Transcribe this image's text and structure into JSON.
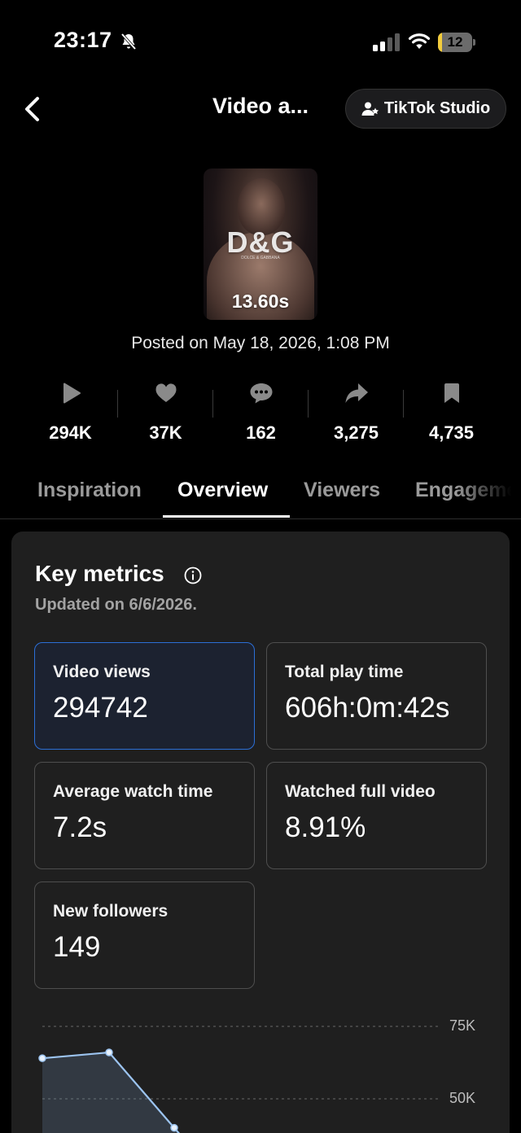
{
  "status_bar": {
    "time": "23:17",
    "battery": "12",
    "battery_level": 0.12
  },
  "header": {
    "title": "Video a...",
    "studio_button": "TikTok Studio"
  },
  "video": {
    "duration": "13.60s",
    "brand": "D&G",
    "brand_sub": "DOLCE & GABBANA",
    "posted": "Posted on May 18, 2026, 1:08 PM"
  },
  "stats": [
    {
      "icon": "play-icon",
      "value": "294K"
    },
    {
      "icon": "heart-icon",
      "value": "37K"
    },
    {
      "icon": "comment-icon",
      "value": "162"
    },
    {
      "icon": "share-icon",
      "value": "3,275"
    },
    {
      "icon": "bookmark-icon",
      "value": "4,735"
    }
  ],
  "tabs": [
    "Inspiration",
    "Overview",
    "Viewers",
    "Engagement"
  ],
  "active_tab": "Overview",
  "key_metrics": {
    "title": "Key metrics",
    "updated": "Updated on 6/6/2026.",
    "metrics": [
      {
        "label": "Video views",
        "value": "294742",
        "selected": true
      },
      {
        "label": "Total play time",
        "value": "606h:0m:42s",
        "selected": false
      },
      {
        "label": "Average watch time",
        "value": "7.2s",
        "selected": false
      },
      {
        "label": "Watched full video",
        "value": "8.91%",
        "selected": false
      },
      {
        "label": "New followers",
        "value": "149",
        "selected": false
      }
    ]
  },
  "chart_data": {
    "type": "area",
    "y_ticks": [
      "75K",
      "50K"
    ],
    "ylim": [
      0,
      75000
    ],
    "values": [
      64000,
      66000,
      40000
    ],
    "series_color": "#9cc4f0"
  }
}
